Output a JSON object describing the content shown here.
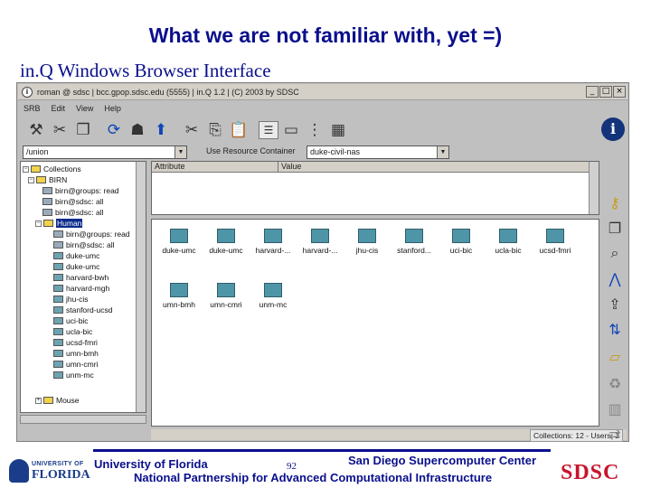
{
  "slide": {
    "title": "What we are not familiar with, yet =)",
    "subtitle": "in.Q Windows Browser Interface"
  },
  "window": {
    "title": "roman @ sdsc | bcc.gpop.sdsc.edu (5555) | in.Q 1.2 | (C) 2003 by SDSC",
    "controls": [
      "_",
      "□",
      "×"
    ],
    "menu": [
      "SRB",
      "Edit",
      "View",
      "Help"
    ],
    "toolbar_icons": [
      "wand-icon",
      "cut-icon",
      "copy-icon",
      "refresh-icon",
      "users-icon",
      "up-arrow-icon",
      "scissors-icon",
      "copy-doc-icon",
      "paste-icon",
      "list-view-icon",
      "icon-view-icon",
      "details-view-icon",
      "grid-view-icon"
    ],
    "collection_combo": "/union",
    "resource_label": "Use Resource  Container",
    "resource_combo": "duke-civil-nas",
    "tree": {
      "root": "Collections",
      "birn": "BIRN",
      "users": [
        "birn@groups: read",
        "birn@sdsc: all",
        "birn@sdsc: all"
      ],
      "human": "Human",
      "human_users": [
        "birn@groups: read",
        "birn@sdsc: all"
      ],
      "children": [
        "duke-umc",
        "duke-umc",
        "harvard-bwh",
        "harvard-mgh",
        "jhu-cis",
        "stanford-ucsd",
        "uci-bic",
        "ucla-bic",
        "ucsd-fmri",
        "umn-bmh",
        "umn-cmri",
        "unm-mc"
      ],
      "mouse": "Mouse"
    },
    "attributes": {
      "col_attribute": "Attribute",
      "col_value": "Value"
    },
    "grid_items": [
      "duke-umc",
      "duke-umc",
      "harvard-...",
      "harvard-...",
      "jhu-cis",
      "stanford...",
      "uci-bic",
      "ucla-bic",
      "ucsd-fmri",
      "umn-bmh",
      "umn-cmri",
      "unm-mc"
    ],
    "status": "Collections: 12 - Users: 2"
  },
  "footer": {
    "uf_small": "UNIVERSITY OF",
    "uf_big": "FLORIDA",
    "left": "University of Florida",
    "page": "92",
    "right": "San Diego Supercomputer Center",
    "bottom": "National Partnership for Advanced Computational Infrastructure",
    "sdsc_logo": "SDSC"
  }
}
